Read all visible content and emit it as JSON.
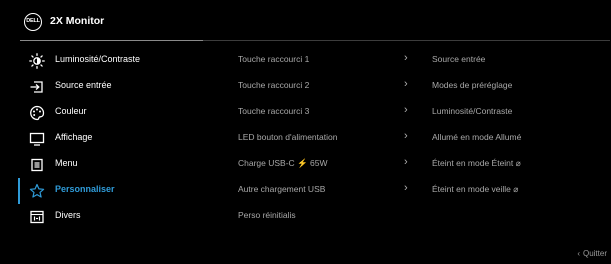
{
  "header": {
    "logo_text": "DELL",
    "title": "2X Monitor"
  },
  "menu": {
    "items": [
      {
        "label": "Luminosité/Contraste",
        "icon": "brightness-icon"
      },
      {
        "label": "Source entrée",
        "icon": "input-source-icon"
      },
      {
        "label": "Couleur",
        "icon": "color-palette-icon"
      },
      {
        "label": "Affichage",
        "icon": "display-icon"
      },
      {
        "label": "Menu",
        "icon": "menu-icon"
      },
      {
        "label": "Personnaliser",
        "icon": "star-icon",
        "active": true
      },
      {
        "label": "Divers",
        "icon": "others-icon"
      }
    ]
  },
  "personalize": {
    "rows": [
      {
        "option": "Touche raccourci 1",
        "value": "Source entrée",
        "has_arrow": true
      },
      {
        "option": "Touche raccourci 2",
        "value": "Modes de  préréglage",
        "has_arrow": true
      },
      {
        "option": "Touche raccourci 3",
        "value": "Luminosité/Contraste",
        "has_arrow": true
      },
      {
        "option": "LED bouton d'alimentation",
        "value": "Allumé en mode Allumé",
        "has_arrow": true
      },
      {
        "option": "Charge USB-C ⚡ 65W",
        "value": "Éteint en mode Éteint",
        "has_arrow": true
      },
      {
        "option": "Autre chargement USB",
        "value": "Éteint en mode veille",
        "has_arrow": true
      },
      {
        "option": "Perso réinitialis",
        "value": "",
        "has_arrow": false
      }
    ]
  },
  "footer": {
    "quit_label": "Quitter"
  },
  "colors": {
    "background": "#000000",
    "accent": "#2f9bd8",
    "text": "#ffffff",
    "muted_text": "#a8a8a8"
  }
}
